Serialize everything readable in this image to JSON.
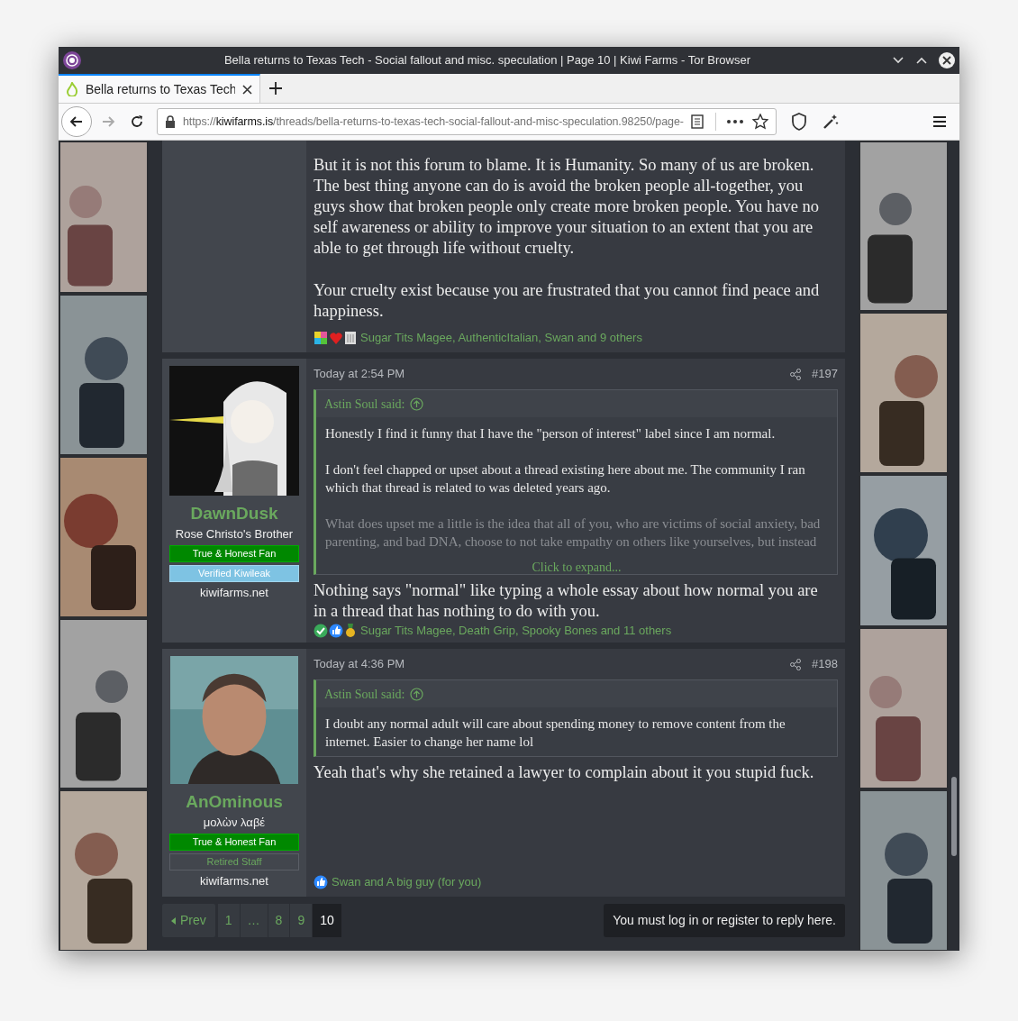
{
  "window": {
    "title": "Bella returns to Texas Tech - Social fallout and misc. speculation | Page 10 | Kiwi Farms - Tor Browser"
  },
  "tabs": [
    {
      "label": "Bella returns to Texas Tech",
      "selected": true
    }
  ],
  "address_bar": {
    "scheme": "https://",
    "host": "kiwifarms.is",
    "path": "/threads/bella-returns-to-texas-tech-social-fallout-and-misc-speculation.98250/page-"
  },
  "posts": [
    {
      "paragraphs": [
        "But it is not this forum to blame. It is Humanity. So many of us are broken. The best thing anyone can do is avoid the broken people all-together, you guys show that broken people only create more broken people. You have no self awareness or ability to improve your situation to an extent that you are able to get through life without cruelty.",
        "Your cruelty exist because you are frustrated that you cannot find peace and happiness."
      ],
      "reactions": {
        "icons": [
          {
            "kind": "puzzle"
          },
          {
            "kind": "heart"
          },
          {
            "kind": "note"
          }
        ],
        "text": "Sugar Tits Magee, AuthenticItalian, Swan and 9 others"
      }
    },
    {
      "user": {
        "name": "DawnDusk",
        "title": "Rose Christo's Brother",
        "badges": [
          {
            "label": "True & Honest Fan",
            "kind": "green"
          },
          {
            "label": "Verified Kiwileak",
            "kind": "blue"
          }
        ],
        "site": "kiwifarms.net"
      },
      "date": "Today at 2:54 PM",
      "number": "#197",
      "quote": {
        "author": "Astin Soul said:",
        "paragraphs": [
          "Honestly I find it funny that I have the \"person of interest\" label since I am normal.",
          "I don't feel chapped or upset about a thread existing here about me. The community I ran which that thread is related to was deleted years ago.",
          "What does upset me a little is the idea that all of you, who are victims of social anxiety, bad parenting, and bad DNA, choose to not take empathy on others like yourselves, but instead"
        ],
        "expand": "Click to expand..."
      },
      "paragraphs": [
        "Nothing says \"normal\" like typing a whole essay about how normal you are in a thread that has nothing to do with you."
      ],
      "reactions": {
        "icons": [
          {
            "kind": "check"
          },
          {
            "kind": "thumb"
          },
          {
            "kind": "medal"
          }
        ],
        "text": "Sugar Tits Magee, Death Grip, Spooky Bones and 11 others"
      }
    },
    {
      "user": {
        "name": "AnOminous",
        "title": "μολὼν λαβέ",
        "badges": [
          {
            "label": "True & Honest Fan",
            "kind": "green"
          },
          {
            "label": "Retired Staff",
            "kind": "outline"
          }
        ],
        "site": "kiwifarms.net"
      },
      "date": "Today at 4:36 PM",
      "number": "#198",
      "quote": {
        "author": "Astin Soul said:",
        "paragraphs": [
          "I doubt any normal adult will care about spending money to remove content from the internet. Easier to change her name lol"
        ]
      },
      "paragraphs": [
        "Yeah that's why she retained a lawyer to complain about it you stupid fuck."
      ],
      "reactions": {
        "icons": [
          {
            "kind": "thumb"
          }
        ],
        "text": "Swan and A big guy (for you)"
      }
    }
  ],
  "pagination": {
    "prev": "Prev",
    "pages": [
      {
        "label": "1",
        "selected": false
      },
      {
        "label": "…",
        "selected": false
      },
      {
        "label": "8",
        "selected": false
      },
      {
        "label": "9",
        "selected": false
      },
      {
        "label": "10",
        "selected": true
      }
    ]
  },
  "reply_notice": "You must log in or register to reply here."
}
